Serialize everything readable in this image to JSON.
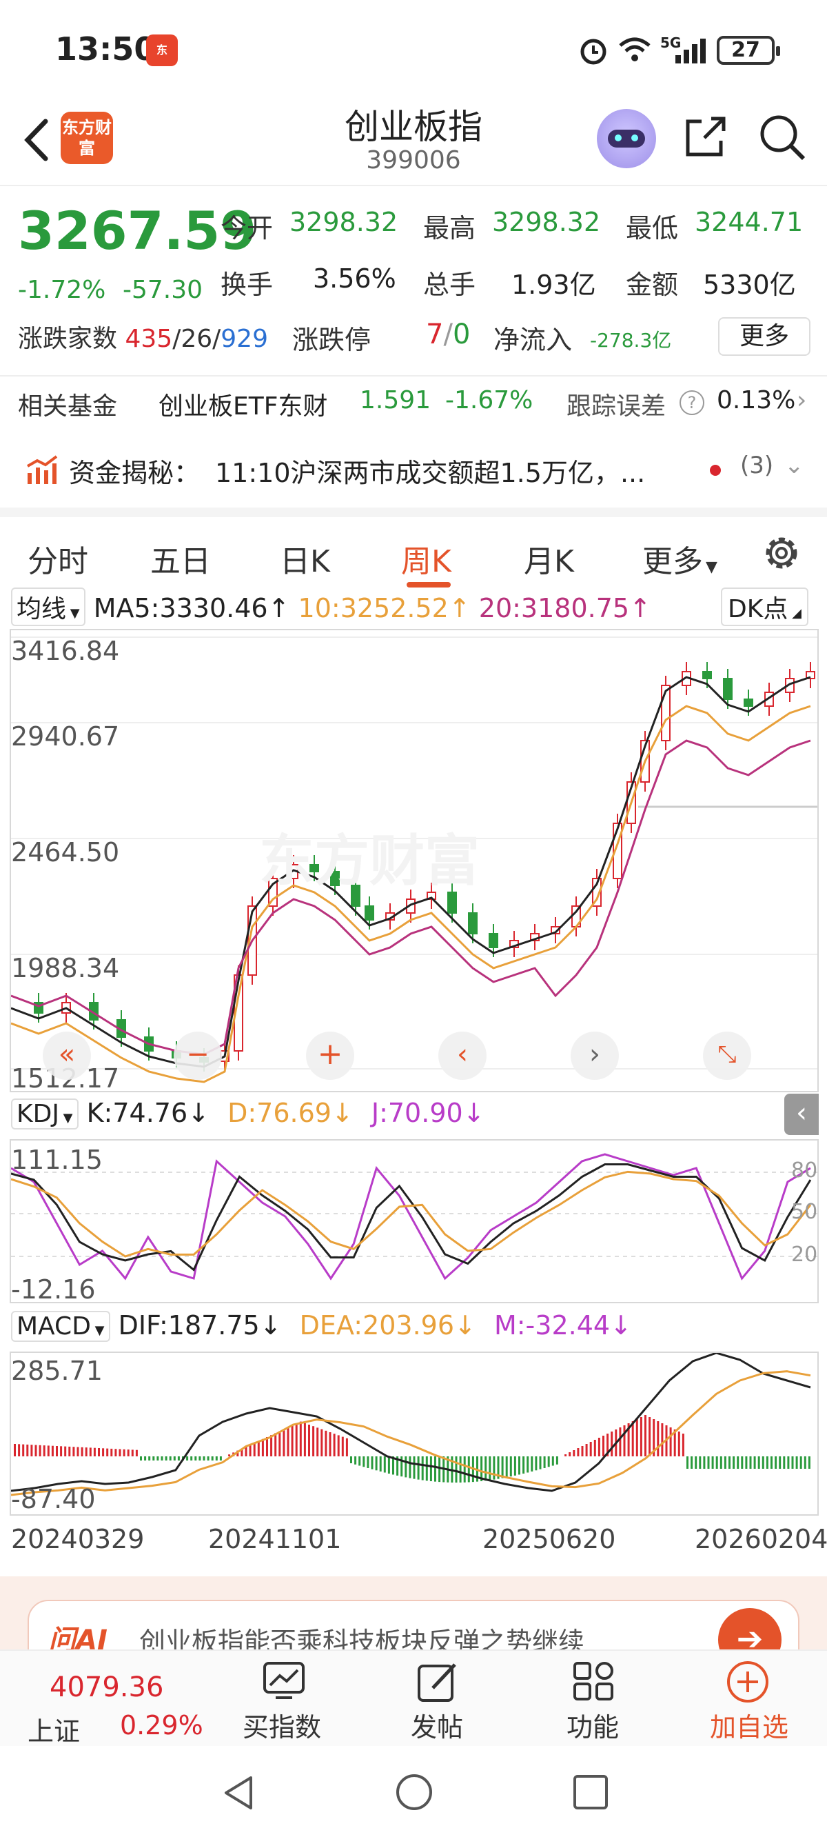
{
  "status_bar": {
    "time": "13:50",
    "app_badge": "东方财富",
    "battery": "27",
    "network": "5G"
  },
  "header": {
    "logo_text": "东方财富",
    "title": "创业板指",
    "code": "399006"
  },
  "quote": {
    "price": "3267.59",
    "change_pct": "-1.72%",
    "change_abs": "-57.30",
    "open_label": "今开",
    "open": "3298.32",
    "high_label": "最高",
    "high": "3298.32",
    "low_label": "最低",
    "low": "3244.71",
    "turnover_label": "换手",
    "turnover": "3.56%",
    "volume_label": "总手",
    "volume": "1.93亿",
    "amount_label": "金额",
    "amount": "5330亿",
    "updown_label": "涨跌家数",
    "up_count": "435",
    "flat_count": "26",
    "down_count": "929",
    "limit_label": "涨跌停",
    "limit_up": "7",
    "limit_down": "0",
    "inflow_label": "净流入",
    "inflow": "-278.3亿",
    "more_label": "更多"
  },
  "fund": {
    "label": "相关基金",
    "name": "创业板ETF东财",
    "price": "1.591",
    "change": "-1.67%",
    "track_label": "跟踪误差",
    "track_value": "0.13%"
  },
  "news": {
    "label": "资金揭秘：",
    "text": "11:10沪深两市成交额超1.5万亿，...",
    "count": "(3)"
  },
  "tabs": [
    "分时",
    "五日",
    "日K",
    "周K",
    "月K",
    "更多"
  ],
  "active_tab": "周K",
  "ma": {
    "select": "均线",
    "ma5": "MA5:3330.46↑",
    "ma10": "10:3252.52↑",
    "ma20": "20:3180.75↑",
    "dk": "DK点"
  },
  "kline": {
    "y_labels": [
      "3416.84",
      "2940.67",
      "2464.50",
      "1988.34",
      "1512.17"
    ],
    "watermark": "东方财富"
  },
  "kdj": {
    "select": "KDJ",
    "k": "K:74.76↓",
    "d": "D:76.69↓",
    "j": "J:70.90↓",
    "y_top": "111.15",
    "y_bottom": "-12.16",
    "levels": [
      "80",
      "50",
      "20"
    ]
  },
  "macd": {
    "select": "MACD",
    "dif": "DIF:187.75↓",
    "dea": "DEA:203.96↓",
    "m": "M:-32.44↓",
    "y_top": "285.71",
    "y_bottom": "-87.40"
  },
  "x_axis": [
    "20240329",
    "20241101",
    "20250620",
    "20260204"
  ],
  "ai_banner": {
    "text": "创业板指能否乘科技板块反弹之势继续"
  },
  "bottom": {
    "index_value": "4079.36",
    "index_name": "上证",
    "index_change": "0.29%",
    "buy_label": "买指数",
    "post_label": "发帖",
    "func_label": "功能",
    "add_label": "加自选"
  },
  "colors": {
    "up": "#d9262e",
    "down": "#2a9a3c",
    "accent": "#e4532a",
    "ma10": "#e8a03a",
    "ma20": "#b8327c"
  }
}
